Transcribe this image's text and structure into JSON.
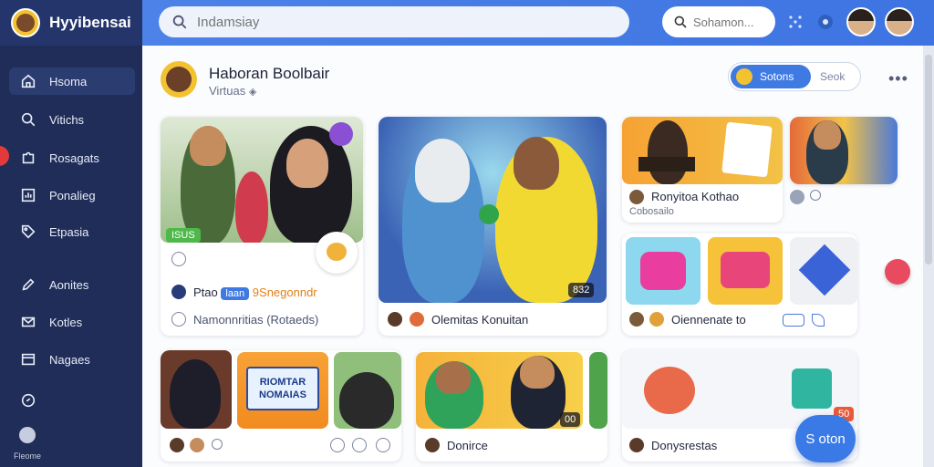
{
  "app": {
    "name": "Hyyibensai"
  },
  "search": {
    "placeholder": "Indamsiay",
    "secondary_placeholder": "Sohamon..."
  },
  "sidebar": {
    "items": [
      {
        "label": "Hsoma",
        "icon": "home-icon"
      },
      {
        "label": "Vitichs",
        "icon": "search-icon"
      },
      {
        "label": "Rosagats",
        "icon": "puzzle-icon"
      },
      {
        "label": "Ponalieg",
        "icon": "chart-icon"
      },
      {
        "label": "Etpasia",
        "icon": "tag-icon"
      },
      {
        "label": "Aonites",
        "icon": "pen-icon"
      },
      {
        "label": "Kotles",
        "icon": "mail-icon"
      },
      {
        "label": "Nagaes",
        "icon": "window-icon"
      }
    ],
    "profile_label": "Fleome"
  },
  "header": {
    "title": "Haboran Boolbair",
    "subtitle": "Virtuas",
    "toggle_on": "Sotons",
    "toggle_off": "Seok"
  },
  "cards": {
    "c1": {
      "badge": "ISUS",
      "line1a": "Ptao",
      "line1pill": "laan",
      "line1b": "9Snegonndr",
      "line2": "Namonnritias (Rotaeds)"
    },
    "c2": {
      "title": "Olemitas Konuitan",
      "tag": "832"
    },
    "c3": {
      "title": "Ronyitoa Kothao",
      "sub": "Cobosailo"
    },
    "c4": {
      "title": "Oiennenate",
      "extra": "to"
    },
    "c5": {
      "banner": "RIOMTAR NOMAIAS"
    },
    "c6": {
      "title": "Donirce",
      "tag": "00"
    },
    "c7": {
      "title": "Donysrestas",
      "tag": "50"
    }
  },
  "fab": {
    "label": "S oton"
  }
}
